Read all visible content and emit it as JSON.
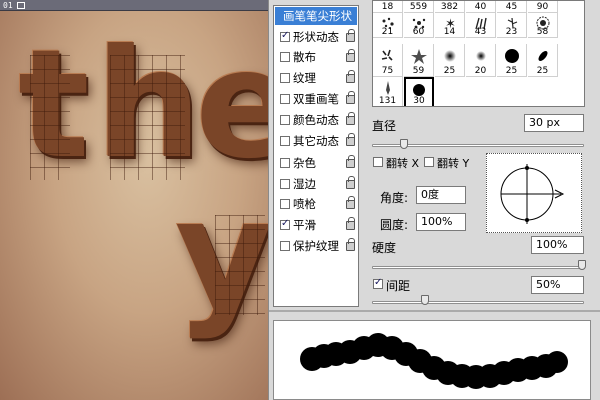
{
  "document_tab": {
    "label": "01"
  },
  "canvas": {
    "letters": [
      "t",
      "h",
      "e",
      "y"
    ]
  },
  "panel": {
    "list": [
      {
        "label": "画笔笔尖形状",
        "selected": true,
        "checkbox": false,
        "lock": false
      },
      {
        "label": "形状动态",
        "checked": true,
        "lock": true
      },
      {
        "label": "散布",
        "checked": false,
        "lock": true
      },
      {
        "label": "纹理",
        "checked": false,
        "lock": true
      },
      {
        "label": "双重画笔",
        "checked": false,
        "lock": true
      },
      {
        "label": "颜色动态",
        "checked": false,
        "lock": true
      },
      {
        "label": "其它动态",
        "checked": false,
        "lock": true
      },
      {
        "label": "杂色",
        "checked": false,
        "lock": true
      },
      {
        "label": "湿边",
        "checked": false,
        "lock": true
      },
      {
        "label": "喷枪",
        "checked": false,
        "lock": true
      },
      {
        "label": "平滑",
        "checked": true,
        "lock": true
      },
      {
        "label": "保护纹理",
        "checked": false,
        "lock": true
      }
    ],
    "presets": {
      "row0": [
        "18",
        "559",
        "382",
        "40",
        "45",
        "90"
      ],
      "row1": [
        "21",
        "60",
        "14",
        "43",
        "23",
        "58"
      ],
      "row2": [
        "75",
        "59",
        "25",
        "20",
        "25",
        "25"
      ],
      "row3": [
        "131",
        "30"
      ],
      "selected": "30"
    },
    "diameter": {
      "label": "直径",
      "value": "30 px"
    },
    "flip_x": {
      "label": "翻转 X"
    },
    "flip_y": {
      "label": "翻转 Y"
    },
    "angle": {
      "label": "角度:",
      "value": "0度"
    },
    "roundness": {
      "label": "圆度:",
      "value": "100%"
    },
    "hardness": {
      "label": "硬度",
      "value": "100%"
    },
    "spacing": {
      "label": "间距",
      "value": "50%",
      "checked": true
    },
    "accent_color": "#3a7fd5"
  }
}
